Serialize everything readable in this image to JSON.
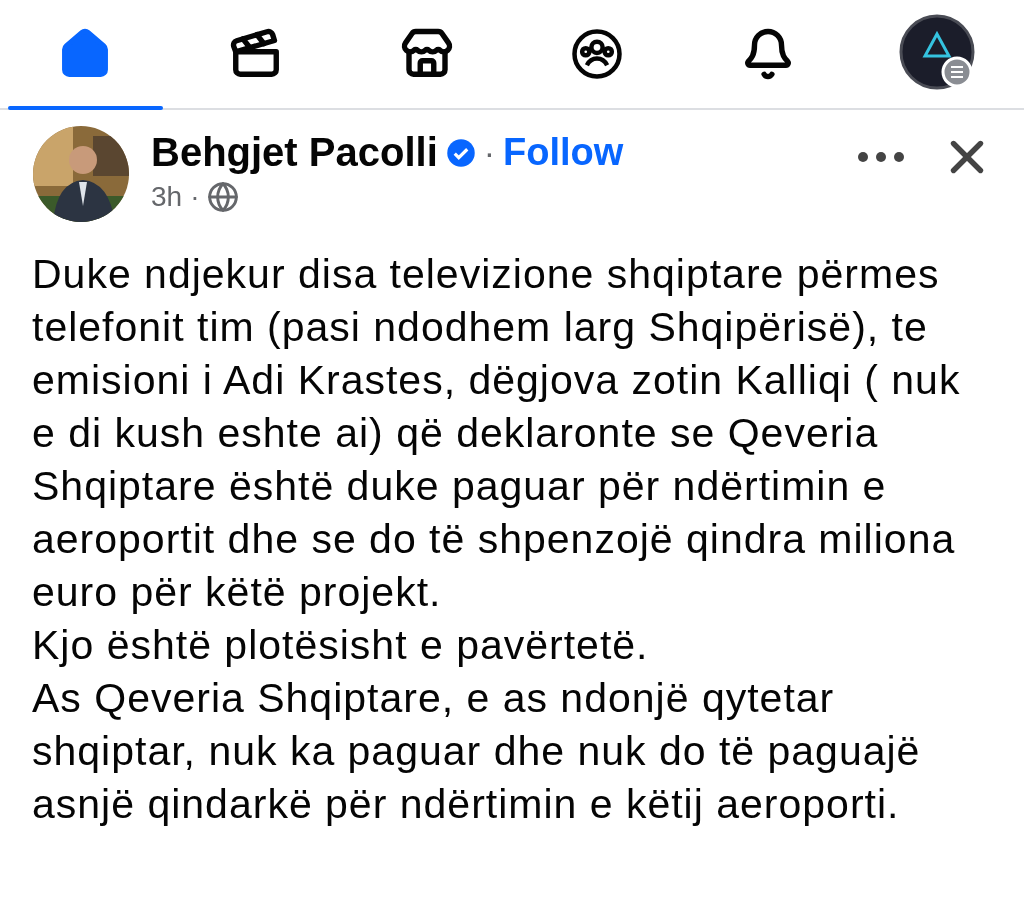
{
  "nav": [
    {
      "kind": "home",
      "selected": true
    },
    {
      "kind": "video",
      "selected": false
    },
    {
      "kind": "store",
      "selected": false
    },
    {
      "kind": "groups",
      "selected": false
    },
    {
      "kind": "bell",
      "selected": false
    },
    {
      "kind": "profile",
      "selected": false
    }
  ],
  "post": {
    "author": "Behgjet Pacolli",
    "verified": true,
    "separator": "·",
    "follow": "Follow",
    "time": "3h",
    "time_separator": "·",
    "paragraphs": [
      "Duke ndjekur disa televizione shqiptare përmes telefonit tim (pasi ndodhem larg Shqipërisë), te emisioni i Adi Krastes, dëgjova zotin Kalliqi ( nuk e di kush eshte ai) që deklaronte se Qeveria Shqiptare është duke paguar për ndërtimin e aeroportit dhe se do të shpenzojë qindra miliona euro për këtë projekt.",
      "Kjo është plotësisht e pavërtetë.",
      "As Qeveria Shqiptare, e as ndonjë qytetar shqiptar, nuk ka paguar dhe nuk do të paguajë asnjë qindarkë për ndërtimin e këtij aeroporti."
    ]
  }
}
